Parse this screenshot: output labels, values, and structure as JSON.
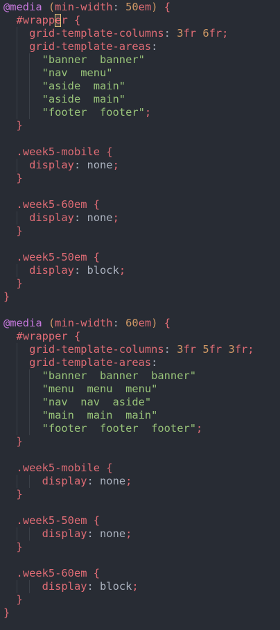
{
  "theme": {
    "background": "#282c34",
    "indent_guide": "#3b4048",
    "cursor": "#e5c07b",
    "tokens": {
      "at": "#c678dd",
      "kw": "#c678dd",
      "punct": "#abb2bf",
      "paren": "#d19a66",
      "prop": "#e06c75",
      "num": "#d19a66",
      "unit": "#e06c75",
      "sel": "#e06c75",
      "str": "#98c379",
      "val": "#abb2bf",
      "plain": "#abb2bf",
      "semi": "#e06c75"
    }
  },
  "editor": {
    "language": "css",
    "cursor": {
      "line": 1,
      "column": 8
    },
    "lines": [
      [
        [
          "at",
          "@media"
        ],
        [
          "plain",
          " "
        ],
        [
          "paren",
          "("
        ],
        [
          "prop",
          "min-width"
        ],
        [
          "punct",
          ": "
        ],
        [
          "num",
          "50"
        ],
        [
          "unit",
          "em"
        ],
        [
          "paren",
          ")"
        ],
        [
          "plain",
          " "
        ],
        [
          "sel",
          "{"
        ]
      ],
      [
        [
          "plain",
          "  "
        ],
        [
          "sel",
          "#wrapper"
        ],
        [
          "plain",
          " "
        ],
        [
          "sel",
          "{"
        ]
      ],
      [
        [
          "plain",
          "    "
        ],
        [
          "prop",
          "grid-template-columns"
        ],
        [
          "punct",
          ": "
        ],
        [
          "num",
          "3"
        ],
        [
          "unit",
          "fr"
        ],
        [
          "plain",
          " "
        ],
        [
          "num",
          "6"
        ],
        [
          "unit",
          "fr"
        ],
        [
          "semi",
          ";"
        ]
      ],
      [
        [
          "plain",
          "    "
        ],
        [
          "prop",
          "grid-template-areas"
        ],
        [
          "punct",
          ":"
        ]
      ],
      [
        [
          "plain",
          "      "
        ],
        [
          "str",
          "\"banner  banner\""
        ]
      ],
      [
        [
          "plain",
          "      "
        ],
        [
          "str",
          "\"nav  menu\""
        ]
      ],
      [
        [
          "plain",
          "      "
        ],
        [
          "str",
          "\"aside  main\""
        ]
      ],
      [
        [
          "plain",
          "      "
        ],
        [
          "str",
          "\"aside  main\""
        ]
      ],
      [
        [
          "plain",
          "      "
        ],
        [
          "str",
          "\"footer  footer\""
        ],
        [
          "semi",
          ";"
        ]
      ],
      [
        [
          "plain",
          "  "
        ],
        [
          "sel",
          "}"
        ]
      ],
      [],
      [
        [
          "plain",
          "  "
        ],
        [
          "sel",
          ".week5-mobile"
        ],
        [
          "plain",
          " "
        ],
        [
          "sel",
          "{"
        ]
      ],
      [
        [
          "plain",
          "    "
        ],
        [
          "prop",
          "display"
        ],
        [
          "punct",
          ": "
        ],
        [
          "val",
          "none"
        ],
        [
          "semi",
          ";"
        ]
      ],
      [
        [
          "plain",
          "  "
        ],
        [
          "sel",
          "}"
        ]
      ],
      [],
      [
        [
          "plain",
          "  "
        ],
        [
          "sel",
          ".week5-60em"
        ],
        [
          "plain",
          " "
        ],
        [
          "sel",
          "{"
        ]
      ],
      [
        [
          "plain",
          "    "
        ],
        [
          "prop",
          "display"
        ],
        [
          "punct",
          ": "
        ],
        [
          "val",
          "none"
        ],
        [
          "semi",
          ";"
        ]
      ],
      [
        [
          "plain",
          "  "
        ],
        [
          "sel",
          "}"
        ]
      ],
      [],
      [
        [
          "plain",
          "  "
        ],
        [
          "sel",
          ".week5-50em"
        ],
        [
          "plain",
          " "
        ],
        [
          "sel",
          "{"
        ]
      ],
      [
        [
          "plain",
          "    "
        ],
        [
          "prop",
          "display"
        ],
        [
          "punct",
          ": "
        ],
        [
          "val",
          "block"
        ],
        [
          "semi",
          ";"
        ]
      ],
      [
        [
          "plain",
          "  "
        ],
        [
          "sel",
          "}"
        ]
      ],
      [
        [
          "sel",
          "}"
        ]
      ],
      [],
      [
        [
          "at",
          "@media"
        ],
        [
          "plain",
          " "
        ],
        [
          "paren",
          "("
        ],
        [
          "prop",
          "min-width"
        ],
        [
          "punct",
          ": "
        ],
        [
          "num",
          "60"
        ],
        [
          "unit",
          "em"
        ],
        [
          "paren",
          ")"
        ],
        [
          "plain",
          " "
        ],
        [
          "sel",
          "{"
        ]
      ],
      [
        [
          "plain",
          "  "
        ],
        [
          "sel",
          "#wrapper"
        ],
        [
          "plain",
          " "
        ],
        [
          "sel",
          "{"
        ]
      ],
      [
        [
          "plain",
          "    "
        ],
        [
          "prop",
          "grid-template-columns"
        ],
        [
          "punct",
          ": "
        ],
        [
          "num",
          "3"
        ],
        [
          "unit",
          "fr"
        ],
        [
          "plain",
          " "
        ],
        [
          "num",
          "5"
        ],
        [
          "unit",
          "fr"
        ],
        [
          "plain",
          " "
        ],
        [
          "num",
          "3"
        ],
        [
          "unit",
          "fr"
        ],
        [
          "semi",
          ";"
        ]
      ],
      [
        [
          "plain",
          "    "
        ],
        [
          "prop",
          "grid-template-areas"
        ],
        [
          "punct",
          ":"
        ]
      ],
      [
        [
          "plain",
          "      "
        ],
        [
          "str",
          "\"banner  banner  banner\""
        ]
      ],
      [
        [
          "plain",
          "      "
        ],
        [
          "str",
          "\"menu  menu  menu\""
        ]
      ],
      [
        [
          "plain",
          "      "
        ],
        [
          "str",
          "\"nav  nav  aside\""
        ]
      ],
      [
        [
          "plain",
          "      "
        ],
        [
          "str",
          "\"main  main  main\""
        ]
      ],
      [
        [
          "plain",
          "      "
        ],
        [
          "str",
          "\"footer  footer  footer\""
        ],
        [
          "semi",
          ";"
        ]
      ],
      [
        [
          "plain",
          "  "
        ],
        [
          "sel",
          "}"
        ]
      ],
      [],
      [
        [
          "plain",
          "  "
        ],
        [
          "sel",
          ".week5-mobile"
        ],
        [
          "plain",
          " "
        ],
        [
          "sel",
          "{"
        ]
      ],
      [
        [
          "plain",
          "      "
        ],
        [
          "prop",
          "display"
        ],
        [
          "punct",
          ": "
        ],
        [
          "val",
          "none"
        ],
        [
          "semi",
          ";"
        ]
      ],
      [
        [
          "plain",
          "  "
        ],
        [
          "sel",
          "}"
        ]
      ],
      [],
      [
        [
          "plain",
          "  "
        ],
        [
          "sel",
          ".week5-50em"
        ],
        [
          "plain",
          " "
        ],
        [
          "sel",
          "{"
        ]
      ],
      [
        [
          "plain",
          "      "
        ],
        [
          "prop",
          "display"
        ],
        [
          "punct",
          ": "
        ],
        [
          "val",
          "none"
        ],
        [
          "semi",
          ";"
        ]
      ],
      [
        [
          "plain",
          "  "
        ],
        [
          "sel",
          "}"
        ]
      ],
      [],
      [
        [
          "plain",
          "  "
        ],
        [
          "sel",
          ".week5-60em"
        ],
        [
          "plain",
          " "
        ],
        [
          "sel",
          "{"
        ]
      ],
      [
        [
          "plain",
          "      "
        ],
        [
          "prop",
          "display"
        ],
        [
          "punct",
          ": "
        ],
        [
          "val",
          "block"
        ],
        [
          "semi",
          ";"
        ]
      ],
      [
        [
          "plain",
          "  "
        ],
        [
          "sel",
          "}"
        ]
      ],
      [
        [
          "sel",
          "}"
        ]
      ]
    ]
  }
}
